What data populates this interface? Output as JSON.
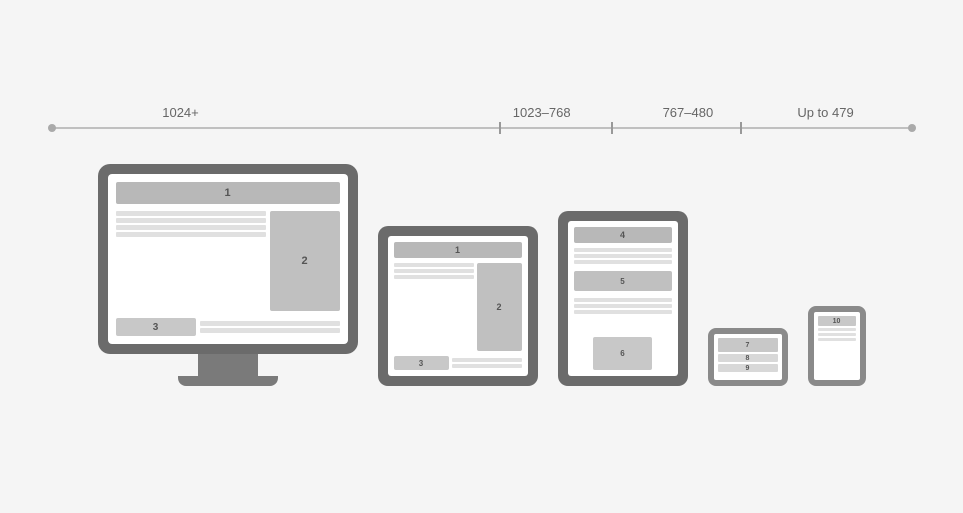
{
  "timeline": {
    "segments": [
      {
        "id": "seg-1024",
        "label": "1024+",
        "left_pct": 25
      },
      {
        "id": "seg-1023-768",
        "label": "1023–768",
        "left_pct": 57
      },
      {
        "id": "seg-767-480",
        "label": "767–480",
        "left_pct": 73
      },
      {
        "id": "seg-up-to-479",
        "label": "Up to 479",
        "left_pct": 88
      }
    ],
    "ticks": [
      52,
      64,
      79
    ]
  },
  "devices": [
    {
      "id": "desktop",
      "type": "monitor",
      "label": "desktop-monitor"
    },
    {
      "id": "tablet-land",
      "type": "tablet-landscape",
      "label": "tablet-landscape"
    },
    {
      "id": "tablet-port",
      "type": "tablet-portrait",
      "label": "tablet-portrait"
    },
    {
      "id": "phone-land",
      "type": "phone-landscape",
      "label": "phone-landscape"
    },
    {
      "id": "phone-port",
      "type": "phone-portrait",
      "label": "phone-portrait"
    }
  ],
  "blocks": {
    "monitor": {
      "header": "1",
      "side": "2",
      "bottom_btn": "3",
      "line_count": 4
    },
    "tablet_land": {
      "header": "1",
      "side": "2",
      "bottom_btn": "3"
    },
    "tablet_port": {
      "header": "4",
      "center": "5",
      "bottom": "6"
    },
    "phone_land": {
      "top": "7",
      "mid1": "8",
      "mid2": "9"
    },
    "phone_port": {
      "top": "10"
    }
  }
}
